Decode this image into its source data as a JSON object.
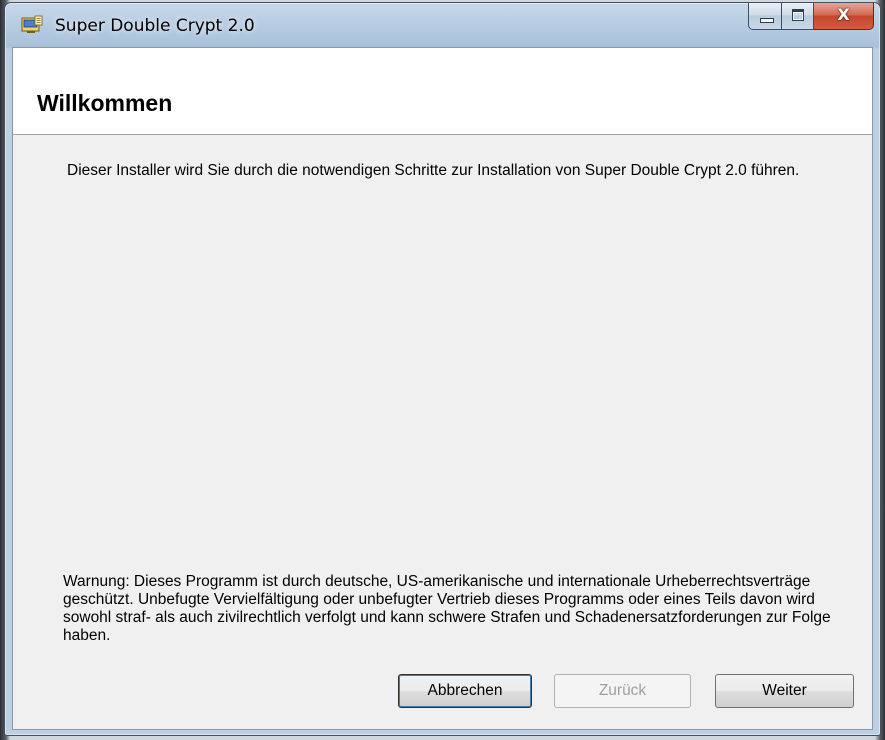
{
  "window": {
    "title": "Super Double Crypt 2.0"
  },
  "caption_buttons": {
    "minimize_icon": "minimize-icon",
    "maximize_icon": "maximize-icon",
    "close_icon": "close-icon",
    "close_glyph": "X"
  },
  "page": {
    "title": "Willkommen",
    "intro": "Dieser Installer wird Sie durch die notwendigen Schritte zur Installation von Super Double Crypt 2.0 führen.",
    "warning": "Warnung: Dieses Programm ist durch deutsche, US-amerikanische und internationale Urheberrechtsverträge geschützt. Unbefugte Vervielfältigung oder unbefugter Vertrieb dieses Programms oder eines Teils davon wird sowohl straf- als auch zivilrechtlich verfolgt und kann schwere Strafen und Schadenersatzforderungen zur Folge haben."
  },
  "buttons": {
    "cancel": "Abbrechen",
    "back": "Zurück",
    "back_enabled": false,
    "next": "Weiter"
  },
  "colors": {
    "close_button": "#c2472f",
    "default_button_focus": "#3c7fb1",
    "disabled_text": "#a0a0a0"
  }
}
